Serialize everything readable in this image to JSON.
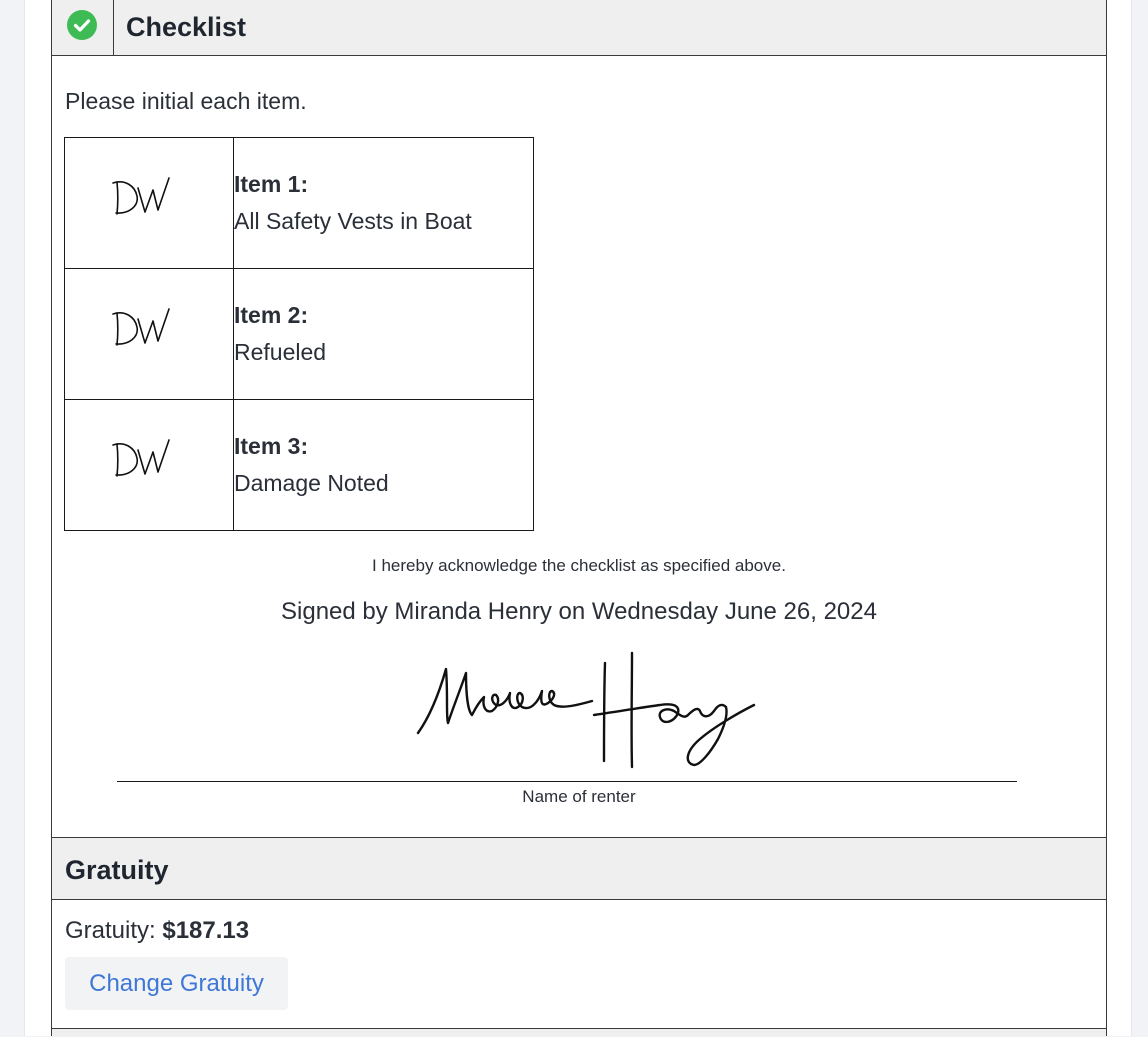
{
  "checklist": {
    "title": "Checklist",
    "status_icon": "check-circle-icon",
    "status_color": "#3fbb55",
    "instruction": "Please initial each item.",
    "items": [
      {
        "label": "Item 1:",
        "text": "All Safety Vests in Boat",
        "initials": "DW"
      },
      {
        "label": "Item 2:",
        "text": "Refueled",
        "initials": "DW"
      },
      {
        "label": "Item 3:",
        "text": "Damage Noted",
        "initials": "DW"
      }
    ],
    "acknowledgement": "I hereby acknowledge the checklist as specified above.",
    "signed_by": "Signed by Miranda Henry on Wednesday June 26, 2024",
    "signature_caption": "Name of renter"
  },
  "gratuity": {
    "title": "Gratuity",
    "label": "Gratuity:",
    "amount": "$187.13",
    "change_button": "Change Gratuity",
    "button_color": "#3f77d6"
  }
}
